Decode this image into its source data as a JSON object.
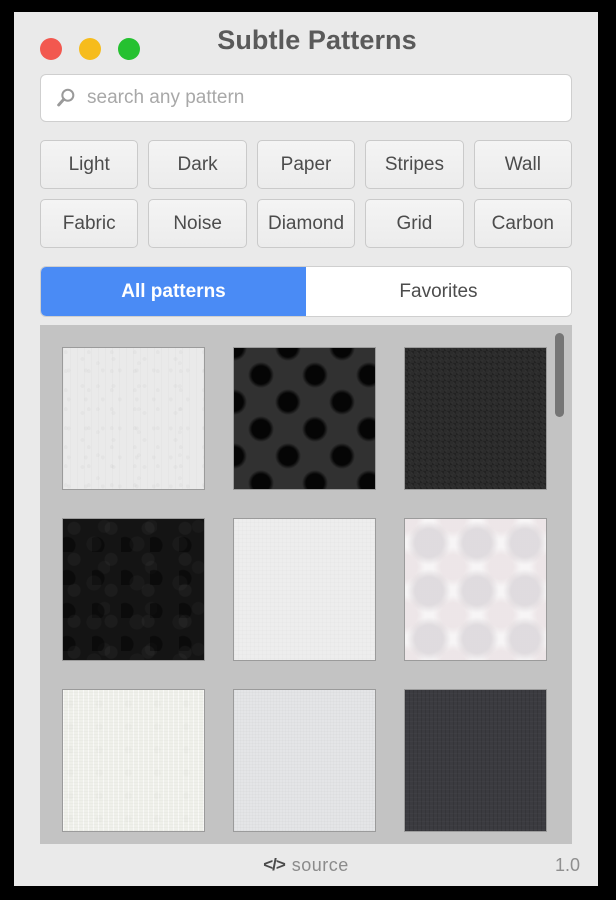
{
  "window": {
    "title": "Subtle Patterns",
    "controls": [
      {
        "name": "close",
        "color": "#f2584f"
      },
      {
        "name": "minimize",
        "color": "#f6bc1c"
      },
      {
        "name": "maximize",
        "color": "#25c130"
      }
    ]
  },
  "search": {
    "placeholder": "search any pattern",
    "value": "",
    "icon": "search-icon"
  },
  "filters": {
    "rows": [
      [
        {
          "label": "Light"
        },
        {
          "label": "Dark"
        },
        {
          "label": "Paper"
        },
        {
          "label": "Stripes"
        },
        {
          "label": "Wall"
        }
      ],
      [
        {
          "label": "Fabric"
        },
        {
          "label": "Noise"
        },
        {
          "label": "Diamond"
        },
        {
          "label": "Grid"
        },
        {
          "label": "Carbon"
        }
      ]
    ]
  },
  "tabs": {
    "active_index": 0,
    "active_color": "#4a8bf5",
    "items": [
      {
        "label": "All patterns"
      },
      {
        "label": "Favorites"
      }
    ]
  },
  "grid": {
    "background_color": "#c3c3c3",
    "tiles": [
      {
        "style": "pat-lightnoise",
        "swatch": "#eaeaea"
      },
      {
        "style": "pat-diamond",
        "swatch": "#313131"
      },
      {
        "style": "pat-darkfiber",
        "swatch": "#2c2c2c"
      },
      {
        "style": "pat-blackleather",
        "swatch": "#141414"
      },
      {
        "style": "pat-whitelinen",
        "swatch": "#ededed"
      },
      {
        "style": "pat-softcheck",
        "swatch": "#f7f5f6"
      },
      {
        "style": "pat-cream",
        "swatch": "#eff0ea"
      },
      {
        "style": "pat-greycloth",
        "swatch": "#e4e5e7"
      },
      {
        "style": "pat-charcoal",
        "swatch": "#3b3b40"
      }
    ],
    "scrollbar": {
      "thumb_color": "#757575",
      "position": "top"
    }
  },
  "footer": {
    "code_icon": "</>",
    "source_label": "source",
    "version": "1.0"
  }
}
